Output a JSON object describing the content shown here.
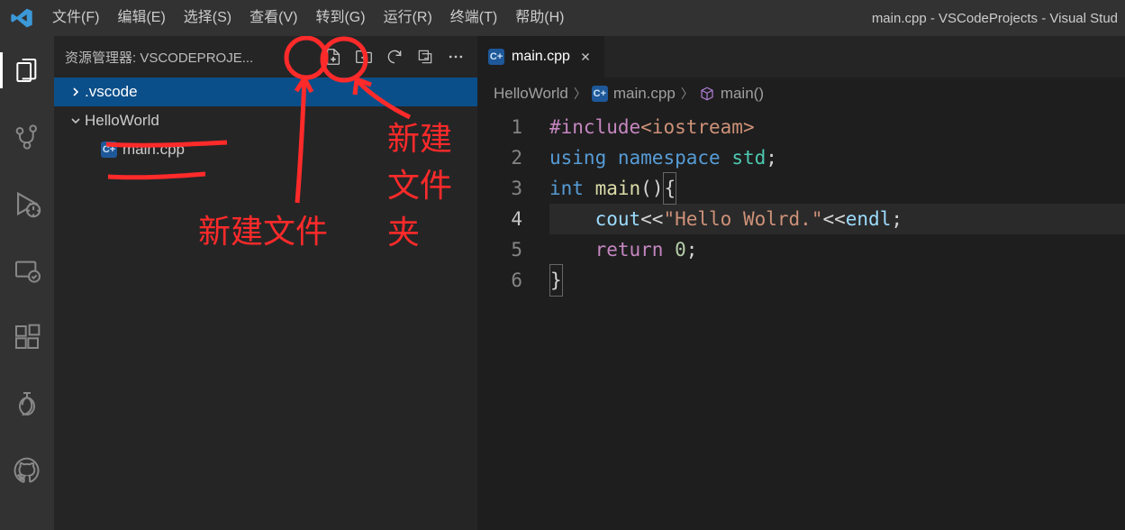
{
  "titlebar": {
    "menu": [
      "文件(F)",
      "编辑(E)",
      "选择(S)",
      "查看(V)",
      "转到(G)",
      "运行(R)",
      "终端(T)",
      "帮助(H)"
    ],
    "title": "main.cpp - VSCodeProjects - Visual Stud"
  },
  "sidebar": {
    "header": "资源管理器: VSCODEPROJE...",
    "tree": {
      "folder1": ".vscode",
      "folder2": "HelloWorld",
      "file1": "main.cpp"
    }
  },
  "tab": {
    "label": "main.cpp"
  },
  "breadcrumbs": {
    "a": "HelloWorld",
    "b": "main.cpp",
    "c": "main()"
  },
  "code": {
    "l1": {
      "a": "#include",
      "b": "<iostream>"
    },
    "l2": {
      "a": "using",
      "b": "namespace",
      "c": "std",
      "d": ";"
    },
    "l3": {
      "a": "int",
      "b": "main",
      "c": "()",
      "d": "{"
    },
    "l4": {
      "a": "cout",
      "b": "<<",
      "c": "\"Hello Wolrd.\"",
      "d": "<<",
      "e": "endl",
      "f": ";"
    },
    "l5": {
      "a": "return",
      "b": "0",
      "c": ";"
    },
    "l6": {
      "a": "}"
    }
  },
  "annotations": {
    "new_file": "新建文件",
    "new_folder": "新建文件夹"
  }
}
